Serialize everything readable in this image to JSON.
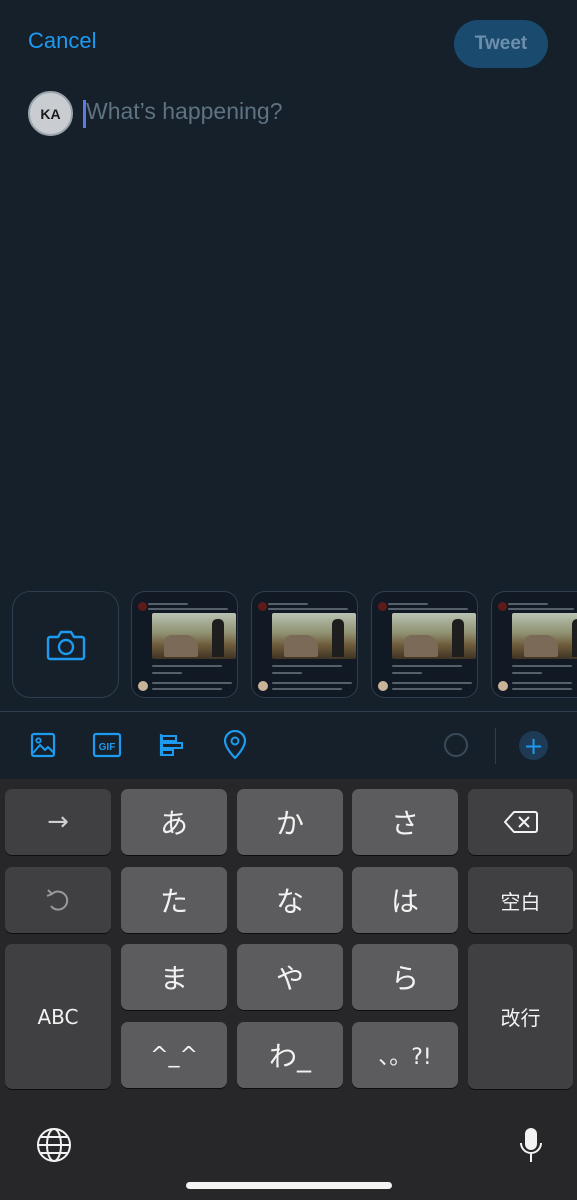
{
  "compose": {
    "cancel_label": "Cancel",
    "tweet_label": "Tweet",
    "avatar_initials": "KA",
    "placeholder": "What’s happening?"
  },
  "media_tray": {
    "camera_icon": "camera-icon",
    "thumbnails": [
      {
        "name": "recent-photo-1"
      },
      {
        "name": "recent-photo-2"
      },
      {
        "name": "recent-photo-3"
      },
      {
        "name": "recent-photo-4"
      }
    ]
  },
  "toolbar": {
    "icons": [
      "image-icon",
      "gif-icon",
      "poll-icon",
      "location-icon"
    ],
    "gif_label": "GIF",
    "add_label": "+"
  },
  "keyboard": {
    "rows": [
      [
        "→",
        "あ",
        "か",
        "さ",
        "delete"
      ],
      [
        "undo",
        "た",
        "な",
        "は",
        "空白"
      ],
      [
        "ABC",
        "ま",
        "や",
        "ら",
        "改行"
      ],
      [
        "",
        "^_^",
        "わ_",
        "、。?!",
        ""
      ]
    ],
    "arrow": "→",
    "a": "あ",
    "ka": "か",
    "sa": "さ",
    "ta": "た",
    "na": "な",
    "ha": "は",
    "space": "空白",
    "abc": "ABC",
    "ma": "ま",
    "ya": "や",
    "ra": "ら",
    "enter": "改行",
    "emoticon": "^_^",
    "wa": "わ_",
    "punct": "、。?!"
  },
  "colors": {
    "background": "#15202b",
    "accent": "#1d9bf0",
    "keyboard": "#272729"
  }
}
